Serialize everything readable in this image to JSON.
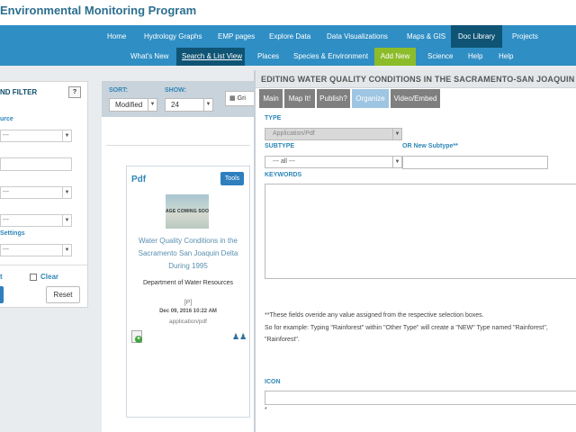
{
  "site": {
    "title": "Environmental Monitoring Program"
  },
  "nav_primary": [
    {
      "label": "Home"
    },
    {
      "label": "Hydrology Graphs"
    },
    {
      "label": "EMP pages"
    },
    {
      "label": "Explore Data"
    },
    {
      "label": "Data Visualizations"
    },
    {
      "label": "Maps & GIS"
    },
    {
      "label": "Doc Library",
      "active": true
    },
    {
      "label": "Projects"
    }
  ],
  "nav_secondary": [
    {
      "label": "What's New"
    },
    {
      "label": "Search & List View",
      "active": true
    },
    {
      "label": "Places"
    },
    {
      "label": "Species & Environment"
    },
    {
      "label": "Add New",
      "accent": "#8dbc2a"
    },
    {
      "label": "Science"
    },
    {
      "label": "Help"
    },
    {
      "label": "Help"
    }
  ],
  "filter": {
    "title": "ND FILTER",
    "help_label": "?",
    "fields": [
      {
        "label": "urce",
        "value": "---"
      },
      {
        "label": "",
        "value": ""
      },
      {
        "label": "",
        "value": "---"
      },
      {
        "label": "",
        "value": "---"
      },
      {
        "label": "Settings",
        "value": "---"
      }
    ],
    "t_label": "t",
    "clear_label": "Clear",
    "reset_label": "Reset"
  },
  "sortbar": {
    "sort_label": "SORT:",
    "sort_value": "Modified",
    "show_label": "SHOW:",
    "show_value": "24",
    "grid_label": "Gri"
  },
  "card": {
    "type": "Pdf",
    "tools_label": "Tools",
    "thumb_text": "AGE COMING SOO",
    "title_line1": "Water Quality Conditions in the",
    "title_line2": "Sacramento San Joaquin Delta",
    "title_line3": "During 1995",
    "org": "Department of Water Resources",
    "bracket": "[P]",
    "date": "Dec 09, 2016 10:22 AM",
    "mime": "application/pdf"
  },
  "edit": {
    "title": "EDITING WATER QUALITY CONDITIONS IN THE SACRAMENTO-SAN JOAQUIN DE",
    "tabs": [
      {
        "label": "Main"
      },
      {
        "label": "Map It!"
      },
      {
        "label": "Publish?"
      },
      {
        "label": "Organize",
        "active": true
      },
      {
        "label": "Video/Embed"
      }
    ],
    "type_label": "TYPE",
    "type_value": "Application/Pdf",
    "subtype_label": "SUBTYPE",
    "subtype_value": "--- all ---",
    "new_subtype_label": "OR New Subtype**",
    "keywords_label": "KEYWORDS",
    "note1": "**These fields overide any value assigned from the respective selection boxes.",
    "note2": "So for example: Typing \"Rainforest\" within \"Other Type\" will create a \"NEW\" Type named \"Rainforest\",",
    "note3": "\"Rainforest\".",
    "icon_label": "ICON",
    "asterisk": "*"
  }
}
